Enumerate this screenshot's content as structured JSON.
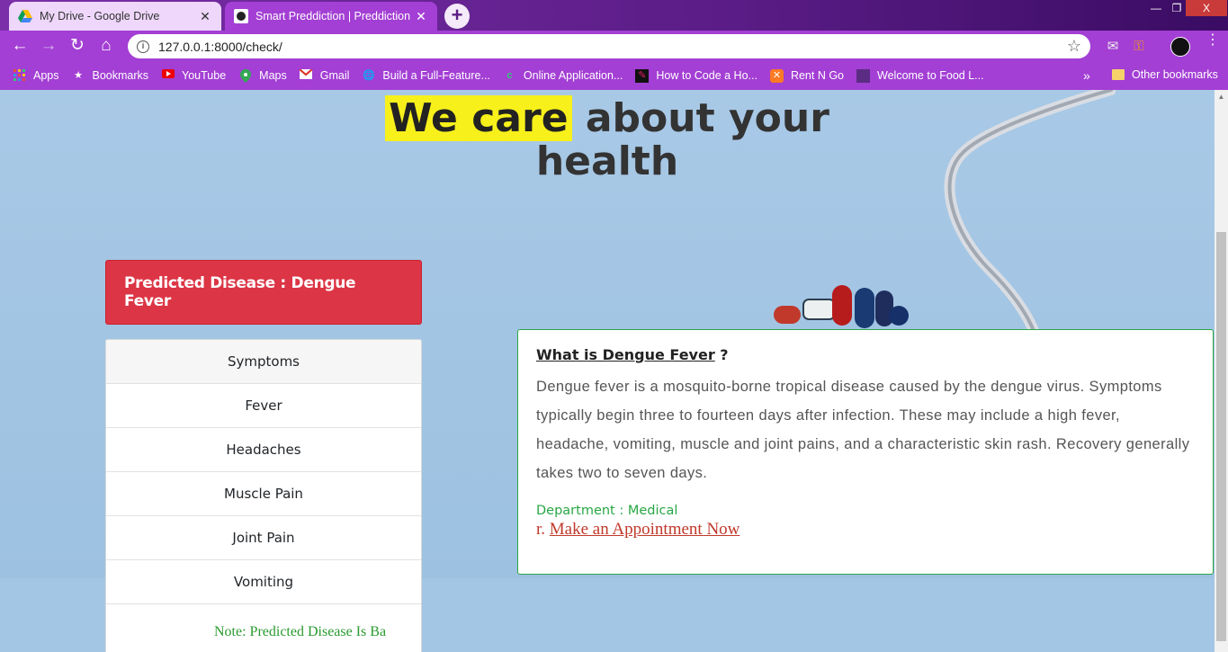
{
  "browser": {
    "tabs": [
      {
        "title": "My Drive - Google Drive",
        "favicon": "google-drive-icon",
        "active": false
      },
      {
        "title": "Smart Preddiction | Preddiction",
        "favicon": "site-logo-icon",
        "active": true
      }
    ],
    "new_tab": "+",
    "window_controls": {
      "minimize": "—",
      "maximize": "❐",
      "close": "X"
    },
    "url": "127.0.0.1:8000/check/",
    "bookmarks": [
      {
        "label": "Apps",
        "icon": "apps-grid-icon"
      },
      {
        "label": "Bookmarks",
        "icon": "star-icon"
      },
      {
        "label": "YouTube",
        "icon": "youtube-icon"
      },
      {
        "label": "Maps",
        "icon": "maps-pin-icon"
      },
      {
        "label": "Gmail",
        "icon": "gmail-icon"
      },
      {
        "label": "Build a Full-Feature...",
        "icon": "globe-icon"
      },
      {
        "label": "Online Application...",
        "icon": "site-c-icon"
      },
      {
        "label": "How to Code a Ho...",
        "icon": "pencil-icon"
      },
      {
        "label": "Rent N Go",
        "icon": "xampp-icon"
      },
      {
        "label": "Welcome to Food L...",
        "icon": "site-icon"
      }
    ],
    "more_bookmarks": "»",
    "other_bookmarks": "Other bookmarks"
  },
  "page": {
    "headline_highlight": "We care",
    "headline_rest": " about your",
    "headline_line2": "health",
    "prediction": "Predicted Disease : Dengue Fever",
    "symptoms_header": "Symptoms",
    "symptoms": [
      "Fever",
      "Headaches",
      "Muscle Pain",
      "Joint Pain",
      "Vomiting"
    ],
    "note": "Note: Predicted Disease Is Ba",
    "card": {
      "question_title": "What is Dengue Fever",
      "question_mark": " ?",
      "description": "Dengue fever is a mosquito-borne tropical disease caused by the dengue virus. Symptoms typically begin three to fourteen days after infection. These may include a high fever, headache, vomiting, muscle and joint pains, and a characteristic skin rash. Recovery generally takes two to seven days.",
      "department": "Department : Medical",
      "appointment_prefix": "r.",
      "appointment_link": "Make an Appointment Now"
    }
  }
}
